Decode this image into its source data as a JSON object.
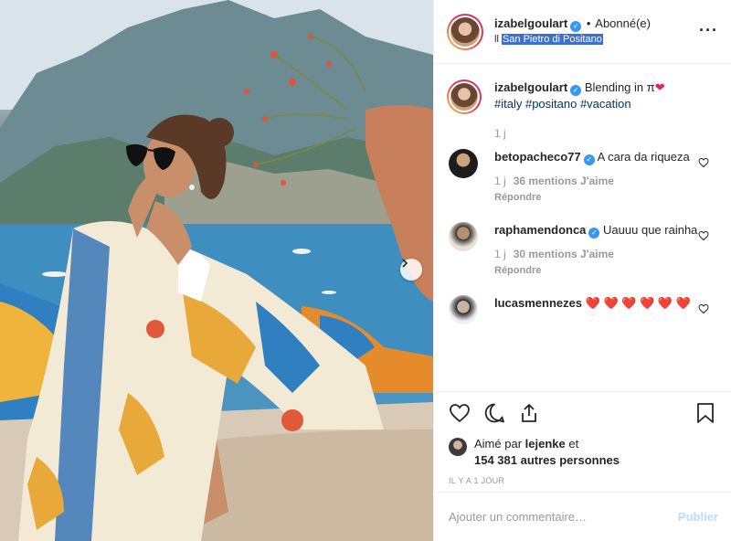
{
  "header": {
    "username": "izabelgoulart",
    "separator": "•",
    "follow_state": "Abonné(e)",
    "location_prefix": "ll",
    "location": "San Pietro di Positano",
    "more_icon": "ellipsis-icon"
  },
  "caption": {
    "username": "izabelgoulart",
    "text": "Blending in π",
    "heart": "❤",
    "tags": "#italy #positano #vacation",
    "time": "1 j"
  },
  "comments": [
    {
      "username": "betopacheco77",
      "verified": true,
      "text": "A cara da riqueza",
      "time": "1 j",
      "likes": "36 mentions J'aime",
      "reply": "Répondre"
    },
    {
      "username": "raphamendonca",
      "verified": true,
      "text": "Uauuu que rainha",
      "time": "1 j",
      "likes": "30 mentions J'aime",
      "reply": "Répondre"
    },
    {
      "username": "lucasmennezes",
      "verified": false,
      "text": "❤️ ❤️ ❤️ ❤️ ❤️ ❤️"
    }
  ],
  "actions": {
    "icons": [
      "heart-icon",
      "comment-icon",
      "share-icon",
      "bookmark-icon"
    ]
  },
  "likes": {
    "prefix": "Aimé par",
    "first_liker": "lejenke",
    "connector": "et",
    "others": "154 381 autres personnes"
  },
  "time_ago": "IL Y A 1 JOUR",
  "composer": {
    "placeholder": "Ajouter un commentaire…",
    "post_label": "Publier"
  },
  "colors": {
    "verified": "#3897f0",
    "link": "#003569",
    "muted": "#999999",
    "post_disabled": "#b2dffc",
    "selection": "#3b6fd4"
  }
}
